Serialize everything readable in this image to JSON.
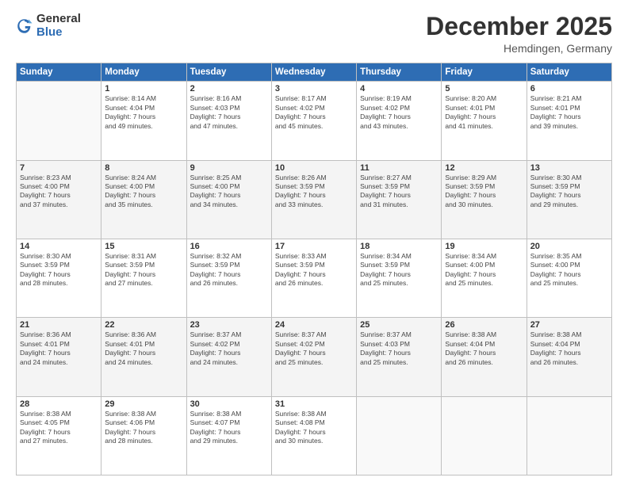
{
  "logo": {
    "general": "General",
    "blue": "Blue"
  },
  "header": {
    "month": "December 2025",
    "location": "Hemdingen, Germany"
  },
  "days_of_week": [
    "Sunday",
    "Monday",
    "Tuesday",
    "Wednesday",
    "Thursday",
    "Friday",
    "Saturday"
  ],
  "weeks": [
    [
      {
        "day": "",
        "sunrise": "",
        "sunset": "",
        "daylight": ""
      },
      {
        "day": "1",
        "sunrise": "Sunrise: 8:14 AM",
        "sunset": "Sunset: 4:04 PM",
        "daylight": "Daylight: 7 hours and 49 minutes."
      },
      {
        "day": "2",
        "sunrise": "Sunrise: 8:16 AM",
        "sunset": "Sunset: 4:03 PM",
        "daylight": "Daylight: 7 hours and 47 minutes."
      },
      {
        "day": "3",
        "sunrise": "Sunrise: 8:17 AM",
        "sunset": "Sunset: 4:02 PM",
        "daylight": "Daylight: 7 hours and 45 minutes."
      },
      {
        "day": "4",
        "sunrise": "Sunrise: 8:19 AM",
        "sunset": "Sunset: 4:02 PM",
        "daylight": "Daylight: 7 hours and 43 minutes."
      },
      {
        "day": "5",
        "sunrise": "Sunrise: 8:20 AM",
        "sunset": "Sunset: 4:01 PM",
        "daylight": "Daylight: 7 hours and 41 minutes."
      },
      {
        "day": "6",
        "sunrise": "Sunrise: 8:21 AM",
        "sunset": "Sunset: 4:01 PM",
        "daylight": "Daylight: 7 hours and 39 minutes."
      }
    ],
    [
      {
        "day": "7",
        "sunrise": "Sunrise: 8:23 AM",
        "sunset": "Sunset: 4:00 PM",
        "daylight": "Daylight: 7 hours and 37 minutes."
      },
      {
        "day": "8",
        "sunrise": "Sunrise: 8:24 AM",
        "sunset": "Sunset: 4:00 PM",
        "daylight": "Daylight: 7 hours and 35 minutes."
      },
      {
        "day": "9",
        "sunrise": "Sunrise: 8:25 AM",
        "sunset": "Sunset: 4:00 PM",
        "daylight": "Daylight: 7 hours and 34 minutes."
      },
      {
        "day": "10",
        "sunrise": "Sunrise: 8:26 AM",
        "sunset": "Sunset: 3:59 PM",
        "daylight": "Daylight: 7 hours and 33 minutes."
      },
      {
        "day": "11",
        "sunrise": "Sunrise: 8:27 AM",
        "sunset": "Sunset: 3:59 PM",
        "daylight": "Daylight: 7 hours and 31 minutes."
      },
      {
        "day": "12",
        "sunrise": "Sunrise: 8:29 AM",
        "sunset": "Sunset: 3:59 PM",
        "daylight": "Daylight: 7 hours and 30 minutes."
      },
      {
        "day": "13",
        "sunrise": "Sunrise: 8:30 AM",
        "sunset": "Sunset: 3:59 PM",
        "daylight": "Daylight: 7 hours and 29 minutes."
      }
    ],
    [
      {
        "day": "14",
        "sunrise": "Sunrise: 8:30 AM",
        "sunset": "Sunset: 3:59 PM",
        "daylight": "Daylight: 7 hours and 28 minutes."
      },
      {
        "day": "15",
        "sunrise": "Sunrise: 8:31 AM",
        "sunset": "Sunset: 3:59 PM",
        "daylight": "Daylight: 7 hours and 27 minutes."
      },
      {
        "day": "16",
        "sunrise": "Sunrise: 8:32 AM",
        "sunset": "Sunset: 3:59 PM",
        "daylight": "Daylight: 7 hours and 26 minutes."
      },
      {
        "day": "17",
        "sunrise": "Sunrise: 8:33 AM",
        "sunset": "Sunset: 3:59 PM",
        "daylight": "Daylight: 7 hours and 26 minutes."
      },
      {
        "day": "18",
        "sunrise": "Sunrise: 8:34 AM",
        "sunset": "Sunset: 3:59 PM",
        "daylight": "Daylight: 7 hours and 25 minutes."
      },
      {
        "day": "19",
        "sunrise": "Sunrise: 8:34 AM",
        "sunset": "Sunset: 4:00 PM",
        "daylight": "Daylight: 7 hours and 25 minutes."
      },
      {
        "day": "20",
        "sunrise": "Sunrise: 8:35 AM",
        "sunset": "Sunset: 4:00 PM",
        "daylight": "Daylight: 7 hours and 25 minutes."
      }
    ],
    [
      {
        "day": "21",
        "sunrise": "Sunrise: 8:36 AM",
        "sunset": "Sunset: 4:01 PM",
        "daylight": "Daylight: 7 hours and 24 minutes."
      },
      {
        "day": "22",
        "sunrise": "Sunrise: 8:36 AM",
        "sunset": "Sunset: 4:01 PM",
        "daylight": "Daylight: 7 hours and 24 minutes."
      },
      {
        "day": "23",
        "sunrise": "Sunrise: 8:37 AM",
        "sunset": "Sunset: 4:02 PM",
        "daylight": "Daylight: 7 hours and 24 minutes."
      },
      {
        "day": "24",
        "sunrise": "Sunrise: 8:37 AM",
        "sunset": "Sunset: 4:02 PM",
        "daylight": "Daylight: 7 hours and 25 minutes."
      },
      {
        "day": "25",
        "sunrise": "Sunrise: 8:37 AM",
        "sunset": "Sunset: 4:03 PM",
        "daylight": "Daylight: 7 hours and 25 minutes."
      },
      {
        "day": "26",
        "sunrise": "Sunrise: 8:38 AM",
        "sunset": "Sunset: 4:04 PM",
        "daylight": "Daylight: 7 hours and 26 minutes."
      },
      {
        "day": "27",
        "sunrise": "Sunrise: 8:38 AM",
        "sunset": "Sunset: 4:04 PM",
        "daylight": "Daylight: 7 hours and 26 minutes."
      }
    ],
    [
      {
        "day": "28",
        "sunrise": "Sunrise: 8:38 AM",
        "sunset": "Sunset: 4:05 PM",
        "daylight": "Daylight: 7 hours and 27 minutes."
      },
      {
        "day": "29",
        "sunrise": "Sunrise: 8:38 AM",
        "sunset": "Sunset: 4:06 PM",
        "daylight": "Daylight: 7 hours and 28 minutes."
      },
      {
        "day": "30",
        "sunrise": "Sunrise: 8:38 AM",
        "sunset": "Sunset: 4:07 PM",
        "daylight": "Daylight: 7 hours and 29 minutes."
      },
      {
        "day": "31",
        "sunrise": "Sunrise: 8:38 AM",
        "sunset": "Sunset: 4:08 PM",
        "daylight": "Daylight: 7 hours and 30 minutes."
      },
      {
        "day": "",
        "sunrise": "",
        "sunset": "",
        "daylight": ""
      },
      {
        "day": "",
        "sunrise": "",
        "sunset": "",
        "daylight": ""
      },
      {
        "day": "",
        "sunrise": "",
        "sunset": "",
        "daylight": ""
      }
    ]
  ]
}
